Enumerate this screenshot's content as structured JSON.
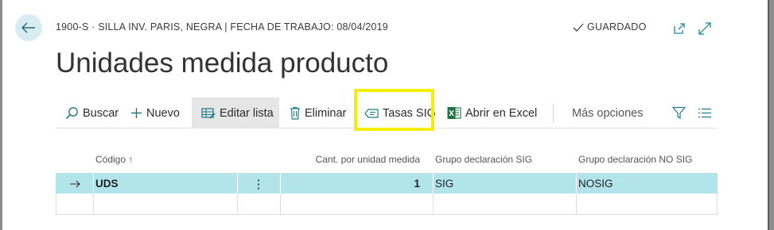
{
  "header": {
    "breadcrumb": "1900-S · SILLA INV. PARIS, NEGRA | FECHA DE TRABAJO: 08/04/2019",
    "saved_label": "GUARDADO",
    "title": "Unidades medida producto"
  },
  "toolbar": {
    "search": "Buscar",
    "new": "Nuevo",
    "edit_list": "Editar lista",
    "delete": "Eliminar",
    "tasas_sig": "Tasas SIG",
    "open_excel": "Abrir en Excel",
    "more_options": "Más opciones"
  },
  "table": {
    "columns": [
      "Código ↑",
      "Cant. por unidad medida",
      "Grupo declaración SIG",
      "Grupo declaración NO SIG"
    ],
    "rows": [
      {
        "codigo": "UDS",
        "menu": "⋮",
        "cantidad": "1",
        "sig": "SIG",
        "nosig": "NOSIG"
      }
    ]
  },
  "colors": {
    "accent": "#00788a",
    "selected_row": "#b1e5eb",
    "highlight_box": "#f4ee00",
    "excel_green": "#1e7145"
  }
}
